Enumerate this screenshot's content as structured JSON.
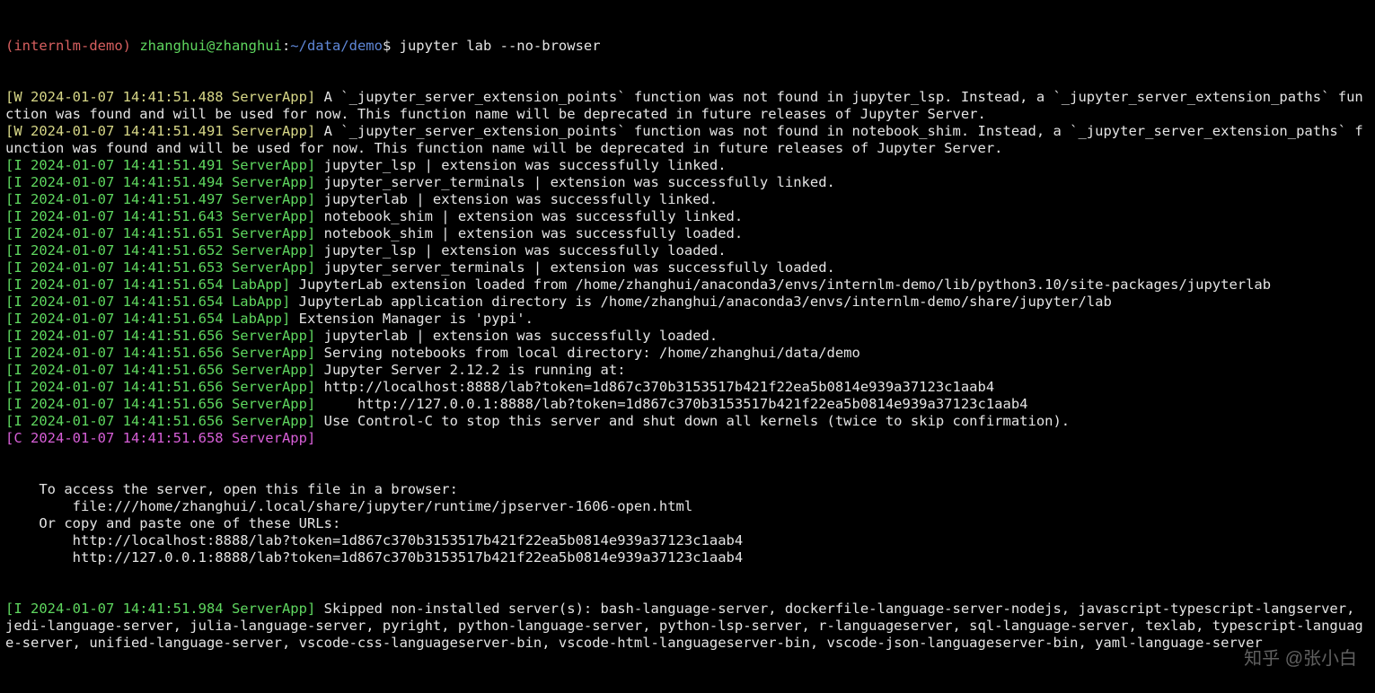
{
  "prompt": {
    "env": "(internlm-demo) ",
    "userhost": "zhanghui@zhanghui",
    "sep": ":",
    "path": "~/data/demo",
    "dollar": "$ ",
    "command": "jupyter lab --no-browser"
  },
  "logs": [
    {
      "level": "W",
      "ts": "2024-01-07 14:41:51.488",
      "src": "ServerApp",
      "msg": "A `_jupyter_server_extension_points` function was not found in jupyter_lsp. Instead, a `_jupyter_server_extension_paths` function was found and will be used for now. This function name will be deprecated in future releases of Jupyter Server."
    },
    {
      "level": "W",
      "ts": "2024-01-07 14:41:51.491",
      "src": "ServerApp",
      "msg": "A `_jupyter_server_extension_points` function was not found in notebook_shim. Instead, a `_jupyter_server_extension_paths` function was found and will be used for now. This function name will be deprecated in future releases of Jupyter Server."
    },
    {
      "level": "I",
      "ts": "2024-01-07 14:41:51.491",
      "src": "ServerApp",
      "msg": "jupyter_lsp | extension was successfully linked."
    },
    {
      "level": "I",
      "ts": "2024-01-07 14:41:51.494",
      "src": "ServerApp",
      "msg": "jupyter_server_terminals | extension was successfully linked."
    },
    {
      "level": "I",
      "ts": "2024-01-07 14:41:51.497",
      "src": "ServerApp",
      "msg": "jupyterlab | extension was successfully linked."
    },
    {
      "level": "I",
      "ts": "2024-01-07 14:41:51.643",
      "src": "ServerApp",
      "msg": "notebook_shim | extension was successfully linked."
    },
    {
      "level": "I",
      "ts": "2024-01-07 14:41:51.651",
      "src": "ServerApp",
      "msg": "notebook_shim | extension was successfully loaded."
    },
    {
      "level": "I",
      "ts": "2024-01-07 14:41:51.652",
      "src": "ServerApp",
      "msg": "jupyter_lsp | extension was successfully loaded."
    },
    {
      "level": "I",
      "ts": "2024-01-07 14:41:51.653",
      "src": "ServerApp",
      "msg": "jupyter_server_terminals | extension was successfully loaded."
    },
    {
      "level": "I",
      "ts": "2024-01-07 14:41:51.654",
      "src": "LabApp",
      "msg": "JupyterLab extension loaded from /home/zhanghui/anaconda3/envs/internlm-demo/lib/python3.10/site-packages/jupyterlab"
    },
    {
      "level": "I",
      "ts": "2024-01-07 14:41:51.654",
      "src": "LabApp",
      "msg": "JupyterLab application directory is /home/zhanghui/anaconda3/envs/internlm-demo/share/jupyter/lab"
    },
    {
      "level": "I",
      "ts": "2024-01-07 14:41:51.654",
      "src": "LabApp",
      "msg": "Extension Manager is 'pypi'."
    },
    {
      "level": "I",
      "ts": "2024-01-07 14:41:51.656",
      "src": "ServerApp",
      "msg": "jupyterlab | extension was successfully loaded."
    },
    {
      "level": "I",
      "ts": "2024-01-07 14:41:51.656",
      "src": "ServerApp",
      "msg": "Serving notebooks from local directory: /home/zhanghui/data/demo"
    },
    {
      "level": "I",
      "ts": "2024-01-07 14:41:51.656",
      "src": "ServerApp",
      "msg": "Jupyter Server 2.12.2 is running at:"
    },
    {
      "level": "I",
      "ts": "2024-01-07 14:41:51.656",
      "src": "ServerApp",
      "msg": "http://localhost:8888/lab?token=1d867c370b3153517b421f22ea5b0814e939a37123c1aab4"
    },
    {
      "level": "I",
      "ts": "2024-01-07 14:41:51.656",
      "src": "ServerApp",
      "msg": "    http://127.0.0.1:8888/lab?token=1d867c370b3153517b421f22ea5b0814e939a37123c1aab4"
    },
    {
      "level": "I",
      "ts": "2024-01-07 14:41:51.656",
      "src": "ServerApp",
      "msg": "Use Control-C to stop this server and shut down all kernels (twice to skip confirmation)."
    },
    {
      "level": "C",
      "ts": "2024-01-07 14:41:51.658",
      "src": "ServerApp",
      "msg": ""
    }
  ],
  "plain_block": [
    "",
    "    To access the server, open this file in a browser:",
    "        file:///home/zhanghui/.local/share/jupyter/runtime/jpserver-1606-open.html",
    "    Or copy and paste one of these URLs:",
    "        http://localhost:8888/lab?token=1d867c370b3153517b421f22ea5b0814e939a37123c1aab4",
    "        http://127.0.0.1:8888/lab?token=1d867c370b3153517b421f22ea5b0814e939a37123c1aab4"
  ],
  "last_log": {
    "level": "I",
    "ts": "2024-01-07 14:41:51.984",
    "src": "ServerApp",
    "msg": "Skipped non-installed server(s): bash-language-server, dockerfile-language-server-nodejs, javascript-typescript-langserver, jedi-language-server, julia-language-server, pyright, python-language-server, python-lsp-server, r-languageserver, sql-language-server, texlab, typescript-language-server, unified-language-server, vscode-css-languageserver-bin, vscode-html-languageserver-bin, vscode-json-languageserver-bin, yaml-language-server"
  },
  "watermark": "知乎 @张小白",
  "colors": {
    "W": "yellow",
    "I": "green",
    "C": "magenta"
  }
}
